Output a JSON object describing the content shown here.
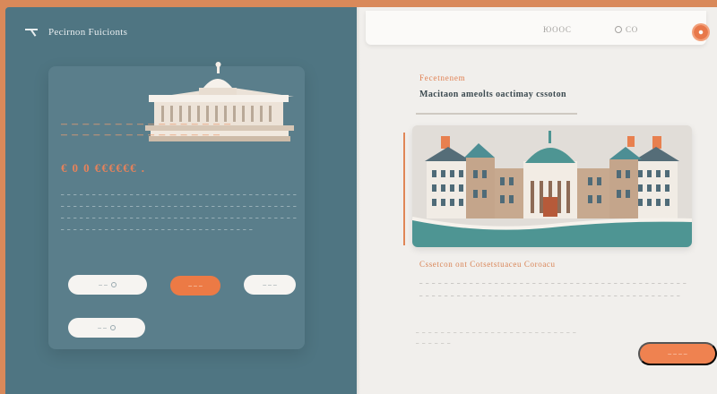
{
  "left_panel": {
    "header_title": "Pecirnon Fuicionts",
    "eyebrow_line_1": "— — — — — — — — — — — — — — — —",
    "eyebrow_line_2": "— — — — — — — — — — — — — — —",
    "big_number": "€ 0 0 €€€€€€ .",
    "body_text": "– – – – – – – – – – – – – – – – – – – – – – – – – – – – – – – – – – – – – – – – – – – – – – – – – – – – – – – – – – – – – – – – – – – – – – – – – – – – – – – – – – – – – – – – – – – – – – – – – – – – – – – – – – – – – – – – – – – – – – – – – – – – – – – – – – – – – – – – – – – – – – – – –",
    "buttons": [
      {
        "label": "– –"
      },
      {
        "label": "– – –"
      },
      {
        "label": "– – –"
      },
      {
        "label": "– –"
      }
    ]
  },
  "right_panel": {
    "topbar_code": "ЮООС",
    "topbar_alt": "СО",
    "eyebrow": "Fecetnenem",
    "title": "Macitaon  ameolts  oactimay  cssoton",
    "subhead": "Cssetcon  ont  Cotsetstuaceu  Coroacu",
    "body_text": "– – – – – – – – – – – – – – – – – – – – – – – – – – – – – – – – – – – – – – – – – – – – – – – – – – – – – – – – – – – – – – – – – – – – – – – – – – – – – – – – – – – – –",
    "body_text_2": "– – – – – – – – – – – – – – – – – – – – – – – – – – – – – – – –",
    "cta_label": "– – – –"
  },
  "colors": {
    "page_bg": "#d9895a",
    "left_bg": "#4f7582",
    "accent_orange": "#ec7a45",
    "right_bg": "#f1efec",
    "teal": "#4e9593"
  },
  "icons": [
    "back-arrow-icon",
    "settings-gear-icon",
    "circle-icon",
    "link-icon"
  ]
}
